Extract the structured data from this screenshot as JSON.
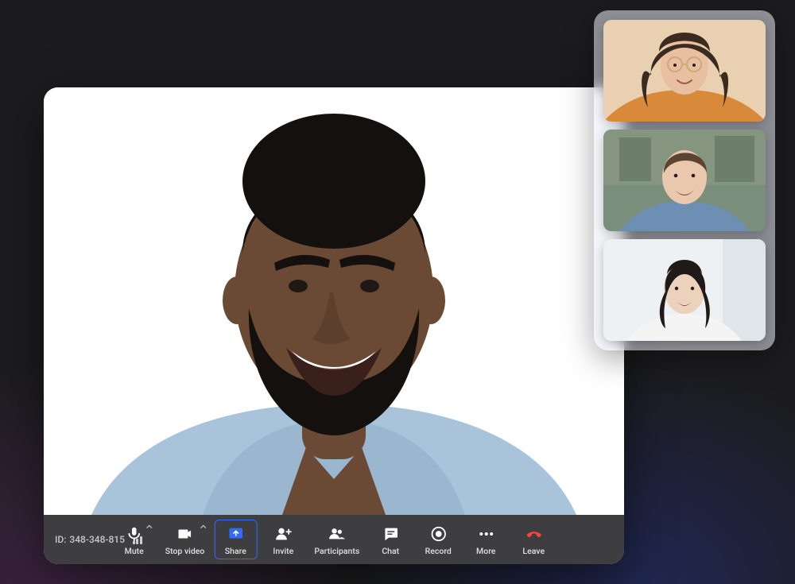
{
  "meeting": {
    "id_prefix": "ID:",
    "id": "348-348-815"
  },
  "toolbar": {
    "mute": {
      "label": "Mute",
      "icon": "microphone-icon",
      "has_chevron": true
    },
    "stop_video": {
      "label": "Stop video",
      "icon": "video-camera-icon",
      "has_chevron": true
    },
    "share": {
      "label": "Share",
      "icon": "share-screen-icon",
      "has_chevron": false,
      "active": true
    },
    "invite": {
      "label": "Invite",
      "icon": "add-user-icon",
      "has_chevron": false
    },
    "participants": {
      "label": "Participants",
      "icon": "participants-icon",
      "has_chevron": false
    },
    "chat": {
      "label": "Chat",
      "icon": "chat-icon",
      "has_chevron": false
    },
    "record": {
      "label": "Record",
      "icon": "record-icon",
      "has_chevron": false
    },
    "more": {
      "label": "More",
      "icon": "more-icon",
      "has_chevron": false
    },
    "leave": {
      "label": "Leave",
      "icon": "hang-up-icon",
      "has_chevron": false
    }
  },
  "participants_thumbnails": [
    {
      "name": "participant-1",
      "bg": "#e9d0b0",
      "skin": "#e8bfa0",
      "hair": "#3a2a1f",
      "shirt": "#d88a3a"
    },
    {
      "name": "participant-2",
      "bg": "#7a8f7b",
      "skin": "#e9c8ad",
      "hair": "#5b4430",
      "shirt": "#6d8fb3"
    },
    {
      "name": "participant-3",
      "bg": "#eef1f3",
      "skin": "#ecd1bd",
      "hair": "#1f1a18",
      "shirt": "#f4f4f4"
    }
  ],
  "main_speaker": {
    "name": "main-speaker",
    "skin": "#6a4a34",
    "hair": "#14100d",
    "shirt": "#a9c4da",
    "bg": "#ffffff"
  },
  "colors": {
    "accent": "#2f6bff",
    "danger": "#ff453a",
    "toolbar_bg": "rgba(20,20,22,0.82)"
  }
}
